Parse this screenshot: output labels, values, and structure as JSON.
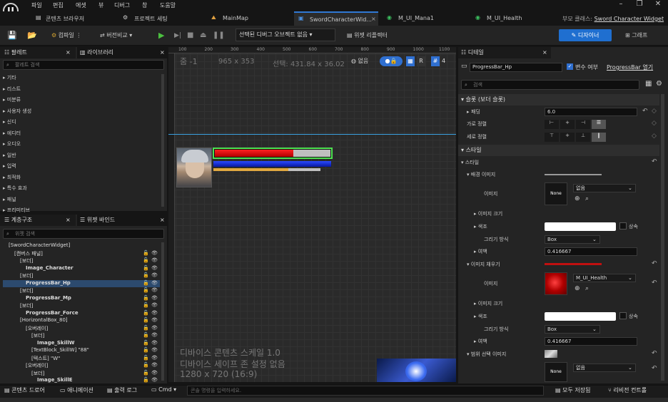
{
  "menu": [
    "파일",
    "편집",
    "에셋",
    "뷰",
    "디버그",
    "창",
    "도움말"
  ],
  "tabs": [
    {
      "label": "콘텐츠 브라우저",
      "icon": "content-browser-icon"
    },
    {
      "label": "프로젝트 세팅",
      "icon": "gear-icon"
    },
    {
      "label": "MainMap",
      "icon": "level-icon"
    },
    {
      "label": "SwordCharacterWid...",
      "icon": "widget-icon"
    },
    {
      "label": "M_UI_Mana1",
      "icon": "material-icon"
    },
    {
      "label": "M_UI_Health",
      "icon": "material-icon"
    }
  ],
  "parent_class": {
    "label": "부모 클래스:",
    "value": "Sword Character Widget"
  },
  "toolbar": {
    "compile": "컴파일",
    "diff": "버전비교",
    "debug_object": "선택된 디버그 오브젝트 없음",
    "reflector": "위젯 리플렉터",
    "designer": "디자이너",
    "graph": "그래프"
  },
  "palette": {
    "title": "팔레트",
    "library": "라이브러리",
    "search_placeholder": "팔레트 검색",
    "items": [
      "기타",
      "리스트",
      "미분류",
      "사용자 생성",
      "신디",
      "에디터",
      "오디오",
      "일반",
      "입력",
      "최적화",
      "특수 효과",
      "패널",
      "프리미티브"
    ]
  },
  "hierarchy": {
    "title": "계층구조",
    "bindings": "위젯 바인드",
    "search_placeholder": "위젯 검색",
    "rows": [
      {
        "label": "[SwordCharacterWidget]",
        "depth": 0
      },
      {
        "label": "[캔버스 패널]",
        "depth": 1
      },
      {
        "label": "[보더]",
        "depth": 2
      },
      {
        "label": "Image_Character",
        "depth": 3
      },
      {
        "label": "[보더]",
        "depth": 2
      },
      {
        "label": "ProgressBar_Hp",
        "depth": 3,
        "selected": true
      },
      {
        "label": "[보더]",
        "depth": 2
      },
      {
        "label": "ProgressBar_Mp",
        "depth": 3
      },
      {
        "label": "[보더]",
        "depth": 2
      },
      {
        "label": "ProgressBar_Force",
        "depth": 3
      },
      {
        "label": "[HorizontalBox_80]",
        "depth": 2
      },
      {
        "label": "[오버레이]",
        "depth": 3
      },
      {
        "label": "[보더]",
        "depth": 4
      },
      {
        "label": "Image_SkillW",
        "depth": 5
      },
      {
        "label": "[TextBlock_SkillW] \"88\"",
        "depth": 4
      },
      {
        "label": "[텍스트] \"W\"",
        "depth": 4
      },
      {
        "label": "[오버레이]",
        "depth": 3
      },
      {
        "label": "[보더]",
        "depth": 4
      },
      {
        "label": "Image_SkillE",
        "depth": 5
      }
    ]
  },
  "viewport": {
    "zoom": "줌 -1",
    "size": "965 x 353",
    "selection": "선택: 431.84 x 36.02",
    "none": "없음",
    "r": "R",
    "grid": "4",
    "ruler": [
      "100",
      "200",
      "300",
      "400",
      "500",
      "600",
      "700",
      "800",
      "900",
      "1000",
      "1100"
    ],
    "device_scale": "디바이스 콘텐츠 스케일 1.0",
    "safe_zone": "디바이스 세이프 존 설정 없음",
    "resolution": "1280 x 720 (16:9)",
    "hp_fill": 0.68,
    "mp_fill": 1.0,
    "force_fill": 0.7
  },
  "details": {
    "title": "디테일",
    "name": "ProgressBar_Hp",
    "is_variable": "변수 여부",
    "open": "ProgressBar 열기",
    "search_placeholder": "검색",
    "slot_section": "슬롯 (보더 슬롯)",
    "padding_label": "패딩",
    "padding_value": "6.0",
    "h_align": "가로 정렬",
    "v_align": "세로 정렬",
    "style_section": "스타일",
    "style_sub": "스타일",
    "bg_image": "배경 이미지",
    "image": "이미지",
    "none_thumb": "None",
    "none_value": "없음",
    "image_size": "이미지 크기",
    "tint": "색조",
    "inherit": "상속",
    "draw_as": "그리기 방식",
    "draw_value": "Box",
    "margin": "여백",
    "margin_value": "0.416667",
    "fill_image": "이미지 채우기",
    "fill_material": "M_UI_Health",
    "marquee": "범위 선택 이미지"
  },
  "bottom": {
    "content_drawer": "콘텐츠 드로어",
    "animation": "애니메이션",
    "output": "출력 로그",
    "cmd": "Cmd",
    "cmd_placeholder": "콘솔 명령을 입력하세요.",
    "save_all": "모두 저장됨",
    "source_control": "리비전 컨트롤"
  }
}
